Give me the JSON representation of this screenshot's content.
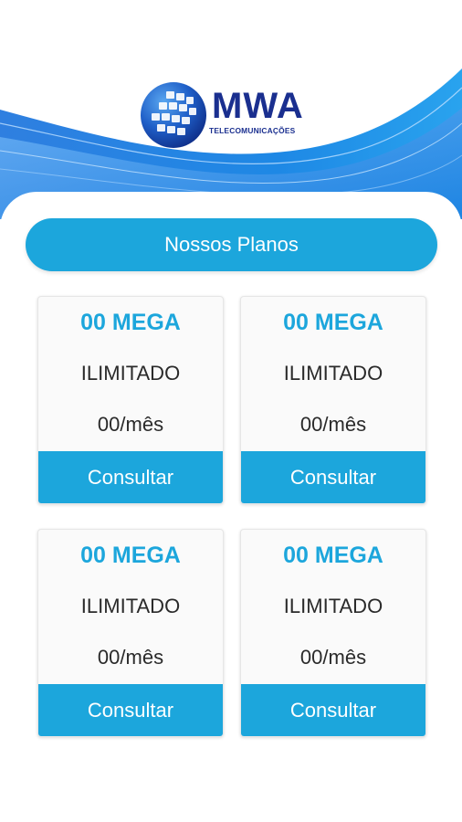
{
  "brand": {
    "name": "MWA",
    "tagline": "TELECOMUNICAÇÕES",
    "colors": {
      "primary": "#1ca6dc",
      "logo_text": "#1a2f8f",
      "wave": "#1e88e5"
    }
  },
  "header": {
    "title": "Nossos Planos"
  },
  "plans": [
    {
      "speed": "00 MEGA",
      "type": "ILIMITADO",
      "price": "00/mês",
      "button": "Consultar"
    },
    {
      "speed": "00 MEGA",
      "type": "ILIMITADO",
      "price": "00/mês",
      "button": "Consultar"
    },
    {
      "speed": "00 MEGA",
      "type": "ILIMITADO",
      "price": "00/mês",
      "button": "Consultar"
    },
    {
      "speed": "00 MEGA",
      "type": "ILIMITADO",
      "price": "00/mês",
      "button": "Consultar"
    }
  ]
}
